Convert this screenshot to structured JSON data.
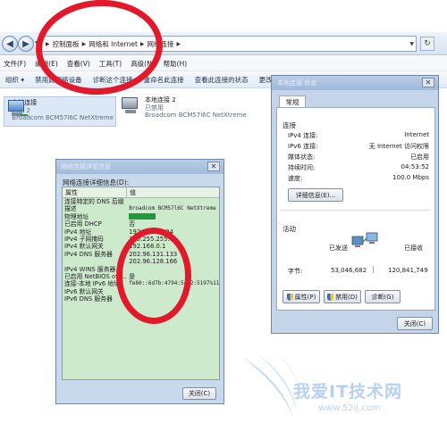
{
  "explorer": {
    "breadcrumb": [
      "控制面板",
      "网络和 Internet",
      "网络连接"
    ],
    "menu": [
      "文件(F)",
      "编辑(E)",
      "查看(V)",
      "工具(T)",
      "高级(N)",
      "帮助(H)"
    ],
    "toolbar": [
      "组织 ▾",
      "禁用此网络设备",
      "诊断这个连接",
      "重命名此连接",
      "查看此连接的状态",
      "更改此连接的设置"
    ],
    "connections": [
      {
        "name": "本地连接",
        "network": "网络 2",
        "adapter": "Broadcom BCM57l6C NetXtreme"
      },
      {
        "name": "本地连接 2",
        "network": "已禁用",
        "adapter": "Broadcom BCM57l6C NetXtreme"
      }
    ]
  },
  "status_dialog": {
    "title": "本地连接 状态",
    "tab": "常规",
    "connection_label": "连接",
    "rows": [
      {
        "k": "IPv4 连接:",
        "v": "Internet"
      },
      {
        "k": "IPv6 连接:",
        "v": "无 Internet 访问权限"
      },
      {
        "k": "媒体状态:",
        "v": "已启用"
      },
      {
        "k": "持续时间:",
        "v": "04:53:52"
      },
      {
        "k": "速度:",
        "v": "100.0 Mbps"
      }
    ],
    "details_button": "详细信息(E)...",
    "activity_label": "活动",
    "sent_label": "已发送",
    "received_label": "已接收",
    "bytes_label": "字节:",
    "bytes_sent": "53,046,682",
    "bytes_received": "120,841,749",
    "properties_button": "属性(P)",
    "disable_button": "禁用(D)",
    "diagnose_button": "诊断(G)",
    "close_button": "关闭(C)"
  },
  "details_dialog": {
    "title": "网络连接详细信息",
    "caption": "网络连接详细信息(D):",
    "col_property": "属性",
    "col_value": "值",
    "rows": [
      {
        "p": "连接特定的 DNS 后缀",
        "v": ""
      },
      {
        "p": "描述",
        "v": "Broadcom BCM57l6C NetXtreme II Gi"
      },
      {
        "p": "物理地址",
        "v": ""
      },
      {
        "p": "已启用 DHCP",
        "v": "否"
      },
      {
        "p": "IPv4 地址",
        "v": "192.168.0.194"
      },
      {
        "p": "IPv4 子网掩码",
        "v": "255.255.255.0"
      },
      {
        "p": "IPv4 默认网关",
        "v": "192.168.0.1"
      },
      {
        "p": "IPv4 DNS 服务器",
        "v": "202.96.131.133"
      },
      {
        "p": "",
        "v": "202.96.128.166"
      },
      {
        "p": "IPv4 WINS 服务器",
        "v": ""
      },
      {
        "p": "已启用 NetBIOS ove...",
        "v": "是"
      },
      {
        "p": "连接-本地 IPv6 地址",
        "v": "fe80::6d7b:4794:5412:5197%11"
      },
      {
        "p": "IPv6 默认网关",
        "v": ""
      },
      {
        "p": "IPv6 DNS 服务器",
        "v": ""
      }
    ],
    "close_button": "关闭(C)"
  },
  "watermark": {
    "text": "我爱IT技术网",
    "url": "www.52ij.com"
  },
  "colors": {
    "annotation": "#e2192a",
    "list_bg": "#cdeacd",
    "mac_highlight": "#1f9a3a"
  }
}
